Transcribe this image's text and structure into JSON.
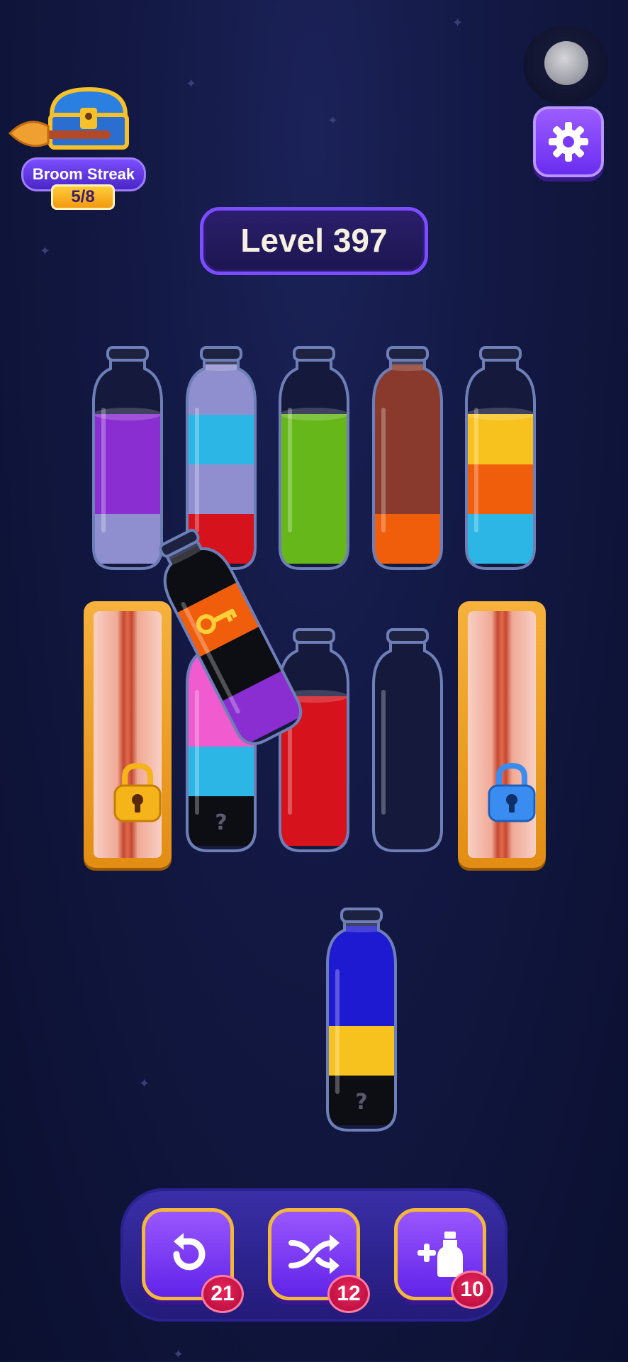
{
  "streak": {
    "label": "Broom Streak",
    "count": "5/8"
  },
  "level": {
    "title": "Level 397"
  },
  "colors": {
    "purple": "#8a2ed1",
    "lavender": "#8f8fcf",
    "sky": "#2cb6e6",
    "red": "#d6121c",
    "green": "#66b81a",
    "brown": "#8a3a2c",
    "orange": "#f05e0c",
    "yellow": "#f7c21d",
    "pink": "#f05bd0",
    "navy": "#1e1ad1",
    "black": "#0d0d14"
  },
  "bottles": [
    {
      "id": "b1",
      "layers": [
        "lavender",
        "purple",
        "purple"
      ],
      "capacity": 4,
      "hidden": 0
    },
    {
      "id": "b2",
      "layers": [
        "red",
        "lavender",
        "sky",
        "lavender"
      ],
      "capacity": 4,
      "hidden": 0
    },
    {
      "id": "b3",
      "layers": [
        "green",
        "green",
        "green"
      ],
      "capacity": 4,
      "hidden": 0
    },
    {
      "id": "b4",
      "layers": [
        "orange",
        "brown",
        "brown",
        "brown"
      ],
      "capacity": 4,
      "hidden": 0
    },
    {
      "id": "b5",
      "layers": [
        "sky",
        "orange",
        "yellow"
      ],
      "capacity": 4,
      "hidden": 0
    },
    {
      "id": "b7",
      "layers": [
        "black",
        "sky",
        "pink",
        "pink"
      ],
      "capacity": 4,
      "hidden": 1
    },
    {
      "id": "b8",
      "layers": [
        "red",
        "red",
        "red"
      ],
      "capacity": 4,
      "hidden": 0
    },
    {
      "id": "b9",
      "layers": [],
      "capacity": 4,
      "hidden": 0
    },
    {
      "id": "b11",
      "layers": [
        "black",
        "yellow",
        "navy",
        "navy"
      ],
      "capacity": 4,
      "hidden": 1
    }
  ],
  "tilted_bottle": {
    "layers": [
      "purple",
      "black",
      "orange",
      "black"
    ],
    "key": "key-icon"
  },
  "hidden_mark": "?",
  "locks": [
    {
      "id": "lock-gold",
      "color": "#f4b41a"
    },
    {
      "id": "lock-blue",
      "color": "#3a8cf0"
    }
  ],
  "tools": {
    "undo": {
      "icon": "undo-icon",
      "count": "21"
    },
    "shuffle": {
      "icon": "shuffle-icon",
      "count": "12"
    },
    "add_bottle": {
      "icon": "add-bottle-icon",
      "count": "10"
    }
  }
}
